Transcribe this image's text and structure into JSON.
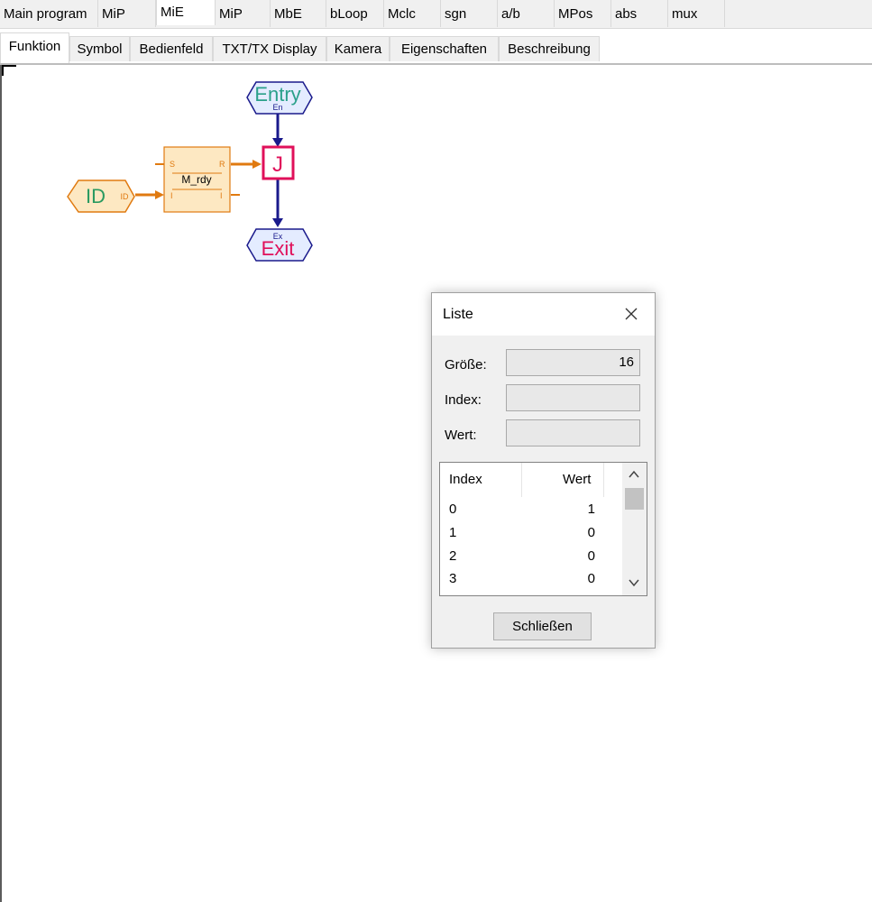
{
  "program_tabs": [
    {
      "label": "Main program",
      "active": false
    },
    {
      "label": "MiP",
      "active": false
    },
    {
      "label": "MiE",
      "active": true
    },
    {
      "label": "MiP",
      "active": false
    },
    {
      "label": "MbE",
      "active": false
    },
    {
      "label": "bLoop",
      "active": false
    },
    {
      "label": "Mclc",
      "active": false
    },
    {
      "label": "sgn",
      "active": false
    },
    {
      "label": "a/b",
      "active": false
    },
    {
      "label": "MPos",
      "active": false
    },
    {
      "label": "abs",
      "active": false
    },
    {
      "label": "mux",
      "active": false
    }
  ],
  "view_tabs": [
    {
      "label": "Funktion",
      "active": true
    },
    {
      "label": "Symbol",
      "active": false
    },
    {
      "label": "Bedienfeld",
      "active": false
    },
    {
      "label": "TXT/TX Display",
      "active": false
    },
    {
      "label": "Kamera",
      "active": false
    },
    {
      "label": "Eigenschaften",
      "active": false
    },
    {
      "label": "Beschreibung",
      "active": false
    }
  ],
  "diagram": {
    "entry": {
      "label": "Entry",
      "port": "En"
    },
    "exit": {
      "label": "Exit",
      "port": "Ex"
    },
    "jump": {
      "label": "J"
    },
    "id_input": {
      "label": "ID",
      "port": "ID"
    },
    "flipflop": {
      "label": "M_rdy",
      "port_s": "S",
      "port_r": "R",
      "port_i_left": "I",
      "port_i_right": "I"
    },
    "colors": {
      "flow": "#1a1a8c",
      "data": "#e07a10",
      "entry_text": "#2aa08a",
      "exit_text": "#e0105a",
      "jump_border": "#e0105a",
      "id_text": "#2a9a60",
      "block_fill": "#fde8c2"
    }
  },
  "dialog": {
    "title": "Liste",
    "fields": {
      "size_label": "Größe:",
      "size_value": "16",
      "index_label": "Index:",
      "index_value": "",
      "value_label": "Wert:",
      "value_value": ""
    },
    "list": {
      "headers": {
        "index": "Index",
        "value": "Wert"
      },
      "rows": [
        {
          "index": "0",
          "value": "1"
        },
        {
          "index": "1",
          "value": "0"
        },
        {
          "index": "2",
          "value": "0"
        },
        {
          "index": "3",
          "value": "0"
        }
      ]
    },
    "close_button": "Schließen"
  }
}
